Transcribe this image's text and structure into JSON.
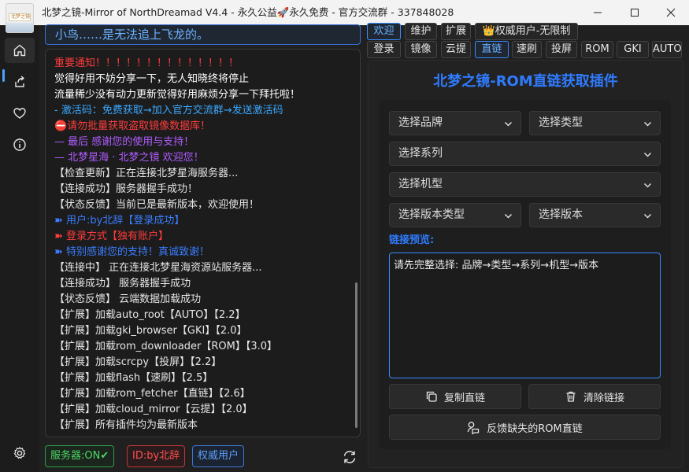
{
  "window": {
    "title": "北梦之镜-Mirror of NorthDreamad V4.4 - 永久公益🚀永久免费 - 官方交流群 - 337848028",
    "logo_text": "北梦之镜"
  },
  "notice": "小鸟……是无法追上飞龙的。",
  "log": [
    {
      "text": "重要通知！！！！！！！！！！！！！！",
      "color": "#ff3b3b"
    },
    {
      "text": "觉得好用不妨分享一下，无人知晓终将停止",
      "color": "#ffffff"
    },
    {
      "text": "流量稀少没有动力更新觉得好用麻烦分享一下拜托啦！",
      "color": "#ffffff"
    },
    {
      "text": "- 激活码：免费获取→加入官方交流群→发送激活码",
      "color": "#3aa7ff"
    },
    {
      "text": "⛔请勿批量获取盗取镜像数据库！",
      "color": "#ff3b3b"
    },
    {
      "text": "— 最后 感谢您的使用与支持！",
      "color": "#b05cff"
    },
    {
      "text": "— 北梦星海 · 北梦之镜 欢迎您！",
      "color": "#b05cff"
    },
    {
      "text": "【检查更新】正在连接北梦星海服务器...",
      "color": "#e6e6e6"
    },
    {
      "text": "【连接成功】服务器握手成功！",
      "color": "#e6e6e6"
    },
    {
      "text": "【状态反馈】当前已是最新版本，欢迎使用！",
      "color": "#e6e6e6"
    },
    {
      "text": "➽ 用户:by北辞【登录成功】",
      "color": "#3a7dff"
    },
    {
      "text": "➽ 登录方式【独有账户】",
      "color": "#ff3b3b"
    },
    {
      "text": "➽ 特别感谢您的支持！真诚致谢！",
      "color": "#3a7dff"
    },
    {
      "text": "【连接中】 正在连接北梦星海资源站服务器...",
      "color": "#e6e6e6"
    },
    {
      "text": "【连接成功】 服务器握手成功",
      "color": "#e6e6e6"
    },
    {
      "text": "【状态反馈】 云端数据加载成功",
      "color": "#e6e6e6"
    },
    {
      "text": "【扩展】加载auto_root【AUTO】【2.2】",
      "color": "#e6e6e6"
    },
    {
      "text": "【扩展】加载gki_browser【GKI】【2.0】",
      "color": "#e6e6e6"
    },
    {
      "text": "【扩展】加载rom_downloader【ROM】【3.0】",
      "color": "#e6e6e6"
    },
    {
      "text": "【扩展】加载scrcpy【投屏】【2.2】",
      "color": "#e6e6e6"
    },
    {
      "text": "【扩展】加载flash【速刷】【2.5】",
      "color": "#e6e6e6"
    },
    {
      "text": "【扩展】加载rom_fetcher【直链】【2.6】",
      "color": "#e6e6e6"
    },
    {
      "text": "【扩展】加载cloud_mirror【云提】【2.0】",
      "color": "#e6e6e6"
    },
    {
      "text": "【扩展】所有插件均为最新版本",
      "color": "#e6e6e6"
    }
  ],
  "status": {
    "server": "服务器:ON✔",
    "user_id": "ID:by北辞",
    "role": "权威用户"
  },
  "tabs_row1": [
    "欢迎",
    "维护",
    "扩展",
    "👑权威用户-无限制"
  ],
  "tabs_row2": [
    "登录",
    "镜像",
    "云提",
    "直链",
    "速刷",
    "投屏",
    "ROM",
    "GKI",
    "AUTO"
  ],
  "plugin": {
    "title": "北梦之镜-ROM直链获取插件",
    "select_brand": "选择品牌",
    "select_type": "选择类型",
    "select_series": "选择系列",
    "select_model": "选择机型",
    "select_version_type": "选择版本类型",
    "select_version": "选择版本",
    "link_label": "链接预览:",
    "preview_text": "请先完整选择: 品牌→类型→系列→机型→版本",
    "copy_button": "复制直链",
    "clear_button": "清除链接",
    "feedback_button": "反馈缺失的ROM直链"
  },
  "colors": {
    "accent": "#3a8bff",
    "server_green": "#4cd964",
    "id_red": "#ff4d4d",
    "role_blue": "#5aa0ff"
  }
}
